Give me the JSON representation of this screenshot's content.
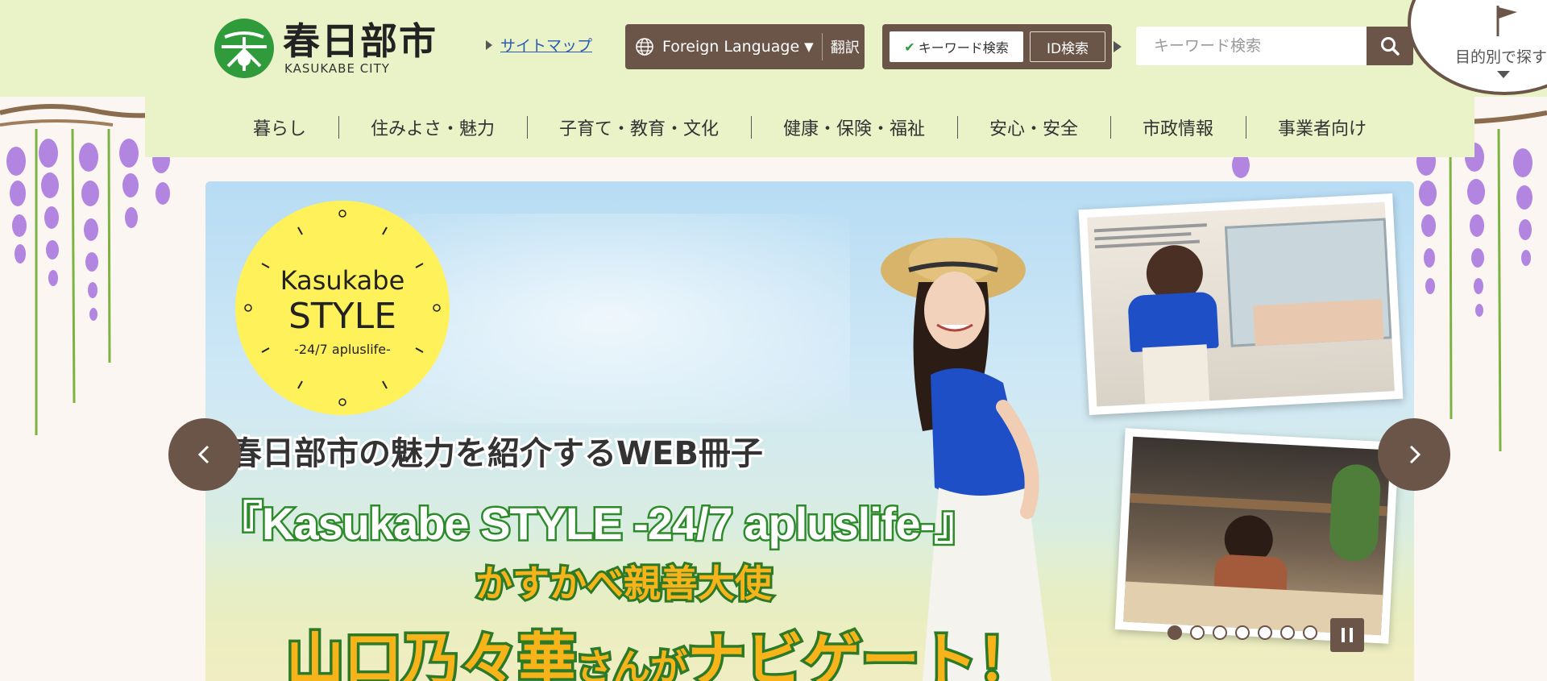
{
  "header": {
    "logo": {
      "name_jp": "春日部市",
      "name_en": "KASUKABE CITY"
    },
    "sitemap_label": "サイトマップ",
    "language": {
      "label": "Foreign Language",
      "caret": "▼",
      "translate_label": "翻訳"
    },
    "search_types": {
      "keyword_label": "キーワード検索",
      "id_label": "ID検索",
      "selected": "キーワード検索"
    },
    "search": {
      "placeholder": "キーワード検索",
      "value": ""
    },
    "purpose_label": "目的別で探す"
  },
  "nav": {
    "items": [
      {
        "label": "暮らし"
      },
      {
        "label": "住みよさ・魅力"
      },
      {
        "label": "子育て・教育・文化"
      },
      {
        "label": "健康・保険・福祉"
      },
      {
        "label": "安心・安全"
      },
      {
        "label": "市政情報"
      },
      {
        "label": "事業者向け"
      }
    ]
  },
  "hero": {
    "badge": {
      "line1": "Kasukabe",
      "line2": "STYLE",
      "line3": "-24/7 apluslife-"
    },
    "subtitle": "春日部市の魅力を紹介するWEB冊子",
    "title": "『Kasukabe STYLE -24/7 apluslife-』",
    "ambassador": "かすかべ親善大使",
    "navi_name": "山口乃々華",
    "navi_mid": "さんが",
    "navi_end": "ナビゲート！"
  },
  "carousel": {
    "slide_count": 7,
    "active_index": 0
  },
  "colors": {
    "brand_brown": "#6b5448",
    "header_green": "#eaf2c8",
    "logo_green": "#2f9b3a",
    "link_blue": "#2a5db0"
  }
}
